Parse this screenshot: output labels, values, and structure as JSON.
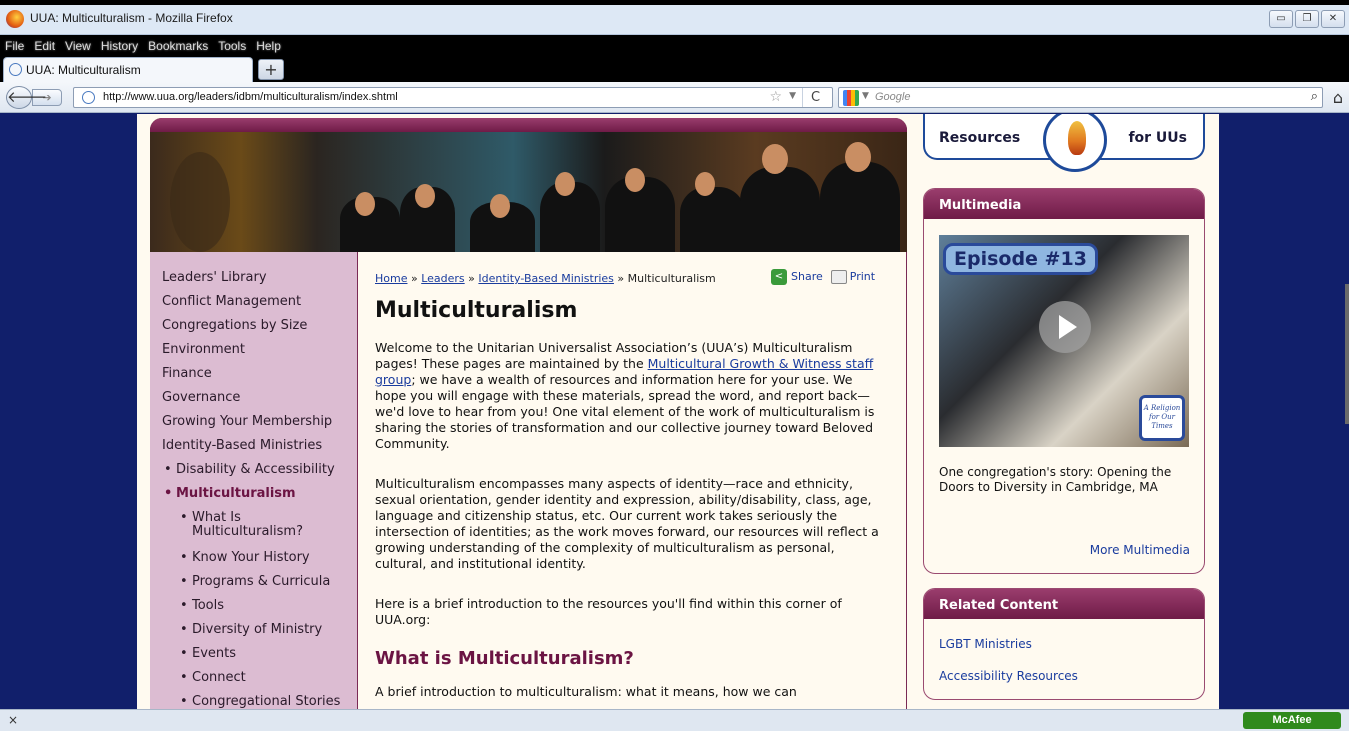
{
  "browser": {
    "window_title": "UUA: Multiculturalism - Mozilla Firefox",
    "menu": [
      "File",
      "Edit",
      "View",
      "History",
      "Bookmarks",
      "Tools",
      "Help"
    ],
    "tab_label": "UUA: Multiculturalism",
    "new_tab_label": "+",
    "url": "http://www.uua.org/leaders/idbm/multiculturalism/index.shtml",
    "search_placeholder": "Google",
    "status_close": "×",
    "addon_label": "McAfee"
  },
  "leftnav": {
    "items": [
      {
        "label": "Leaders' Library",
        "level": 0
      },
      {
        "label": "Conflict Management",
        "level": 0
      },
      {
        "label": "Congregations by Size",
        "level": 0
      },
      {
        "label": "Environment",
        "level": 0
      },
      {
        "label": "Finance",
        "level": 0
      },
      {
        "label": "Governance",
        "level": 0
      },
      {
        "label": "Growing Your Membership",
        "level": 0
      },
      {
        "label": "Identity-Based Ministries",
        "level": 0
      },
      {
        "label": "Disability & Accessibility",
        "level": 1
      },
      {
        "label": "Multiculturalism",
        "level": 1,
        "active": true
      },
      {
        "label": "What Is Multiculturalism?",
        "level": 2
      },
      {
        "label": "Know Your History",
        "level": 2
      },
      {
        "label": "Programs & Curricula",
        "level": 2
      },
      {
        "label": "Tools",
        "level": 2
      },
      {
        "label": "Diversity of Ministry",
        "level": 2
      },
      {
        "label": "Events",
        "level": 2
      },
      {
        "label": "Connect",
        "level": 2
      },
      {
        "label": "Congregational Stories",
        "level": 2
      }
    ]
  },
  "main": {
    "breadcrumb": {
      "home": "Home",
      "sep": "»",
      "leaders": "Leaders",
      "ibm": "Identity-Based Ministries",
      "current": "Multiculturalism"
    },
    "share_label": "Share",
    "print_label": "Print",
    "title": "Multiculturalism",
    "p1_before": "Welcome to the Unitarian Universalist Association’s (UUA’s) Multiculturalism pages! These pages are maintained by the ",
    "p1_link": "Multicultural Growth & Witness staff group",
    "p1_after": "; we have a wealth of resources and information here for your use. We hope you will engage with these materials, spread the word, and report back—we'd love to hear from you! One vital element of the work of multiculturalism is sharing the stories of transformation and our collective journey toward Beloved Community.",
    "p2": "Multiculturalism encompasses many aspects of identity—race and ethnicity, sexual orientation, gender identity and expression, ability/disability, class, age, language and citizenship status, etc. Our current work takes seriously the intersection of identities; as the work moves forward, our resources will reflect a growing understanding of the complexity of multiculturalism as personal, cultural, and institutional identity.",
    "p3": "Here is a brief introduction to the resources you'll find within this corner of UUA.org:",
    "h2": "What is Multiculturalism?",
    "p4": "A brief introduction to multiculturalism: what it means, how we can"
  },
  "right": {
    "resources_left": "Resources",
    "resources_right": "for UUs",
    "multimedia_title": "Multimedia",
    "video_episode": "Episode #13",
    "video_badge": "A Religion for Our Times",
    "video_caption": "One congregation's story: Opening the Doors to Diversity in Cambridge, MA",
    "more_multimedia": "More Multimedia",
    "related_title": "Related Content",
    "related_links": [
      "LGBT Ministries",
      "Accessibility Resources"
    ]
  }
}
